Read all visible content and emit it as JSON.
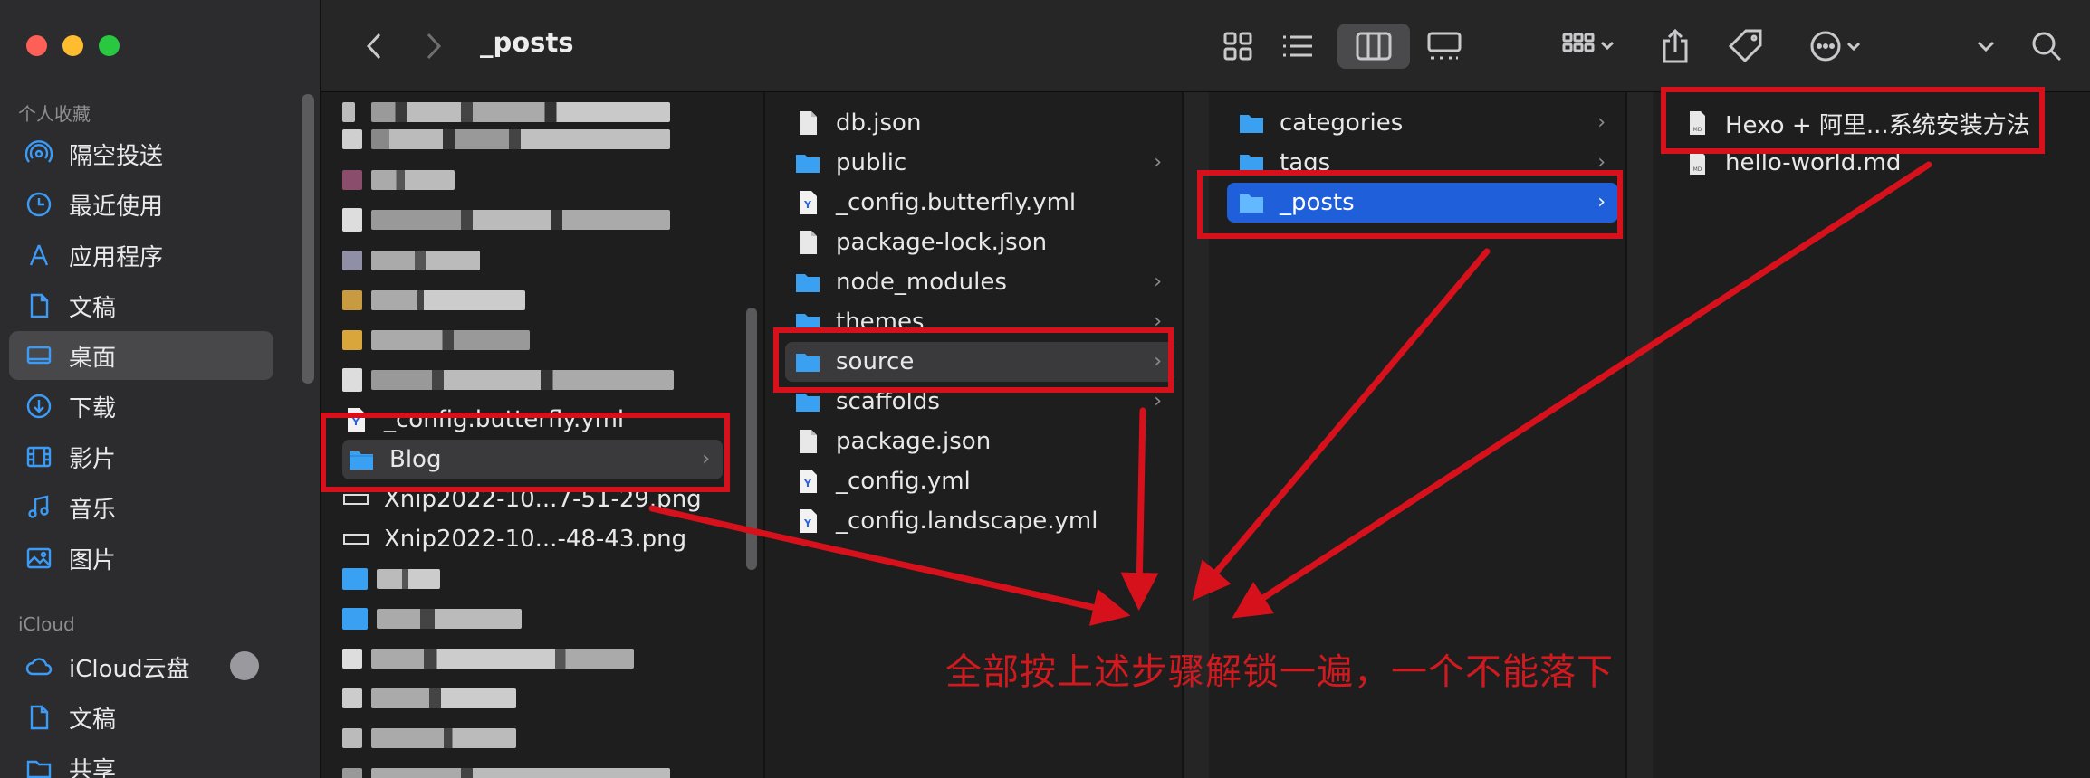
{
  "window": {
    "title": "_posts"
  },
  "sidebar": {
    "favorites_header": "个人收藏",
    "icloud_header": "iCloud",
    "favorites": [
      {
        "label": "隔空投送",
        "icon": "airdrop-icon"
      },
      {
        "label": "最近使用",
        "icon": "clock-icon"
      },
      {
        "label": "应用程序",
        "icon": "applications-icon"
      },
      {
        "label": "文稿",
        "icon": "document-icon"
      },
      {
        "label": "桌面",
        "icon": "desktop-icon",
        "selected": true
      },
      {
        "label": "下载",
        "icon": "download-icon"
      },
      {
        "label": "影片",
        "icon": "film-icon"
      },
      {
        "label": "音乐",
        "icon": "music-icon"
      },
      {
        "label": "图片",
        "icon": "photo-icon"
      }
    ],
    "icloud": [
      {
        "label": "iCloud云盘",
        "icon": "cloud-icon"
      },
      {
        "label": "文稿",
        "icon": "document-icon"
      },
      {
        "label": "共享",
        "icon": "shared-folder-icon"
      }
    ]
  },
  "columns": {
    "desktop": {
      "visible_items": [
        {
          "label": "_config.butterfly.yml",
          "type": "yml"
        },
        {
          "label": "Blog",
          "type": "folder",
          "selected": true
        },
        {
          "label": "Xnip2022-10...7-51-29.png",
          "type": "png"
        },
        {
          "label": "Xnip2022-10...-48-43.png",
          "type": "png"
        }
      ]
    },
    "blog": {
      "items": [
        {
          "label": "db.json",
          "type": "file"
        },
        {
          "label": "public",
          "type": "folder",
          "has_children": true
        },
        {
          "label": "_config.butterfly.yml",
          "type": "yml"
        },
        {
          "label": "package-lock.json",
          "type": "file"
        },
        {
          "label": "node_modules",
          "type": "folder",
          "has_children": true
        },
        {
          "label": "themes",
          "type": "folder",
          "has_children": true
        },
        {
          "label": "source",
          "type": "folder",
          "has_children": true,
          "selected": true
        },
        {
          "label": "scaffolds",
          "type": "folder",
          "has_children": true
        },
        {
          "label": "package.json",
          "type": "file"
        },
        {
          "label": "_config.yml",
          "type": "yml"
        },
        {
          "label": "_config.landscape.yml",
          "type": "yml"
        }
      ]
    },
    "source": {
      "items": [
        {
          "label": "categories",
          "type": "folder",
          "has_children": true
        },
        {
          "label": "tags",
          "type": "folder",
          "has_children": true
        },
        {
          "label": "_posts",
          "type": "folder",
          "has_children": true,
          "selected": true
        }
      ]
    },
    "posts": {
      "items": [
        {
          "label": "Hexo + 阿里...系统安装方法",
          "type": "md"
        },
        {
          "label": "hello-world.md",
          "type": "md"
        }
      ]
    }
  },
  "annotation": {
    "text": "全部按上述步骤解锁一遍，一个不能落下",
    "color": "#d7111c"
  },
  "colors": {
    "folder_blue": "#3aa0f2",
    "selection_blue": "#1f5fd9",
    "accent_red": "#d7111c"
  }
}
